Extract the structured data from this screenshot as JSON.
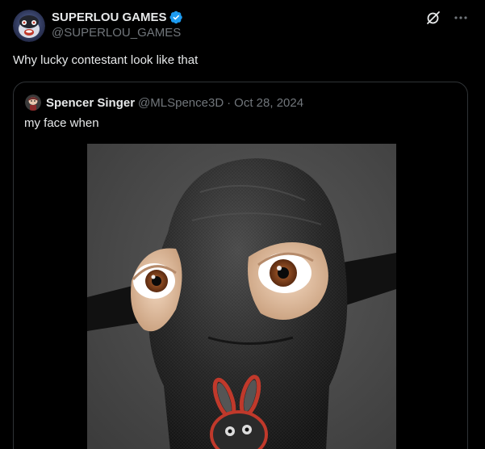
{
  "post": {
    "author_name": "SUPERLOU GAMES",
    "author_handle": "@SUPERLOU_GAMES",
    "text": "Why lucky contestant look like that"
  },
  "quote": {
    "author_name": "Spencer Singer",
    "author_handle": "@MLSpence3D",
    "separator": "·",
    "date": "Oct 28, 2024",
    "text": "my face when"
  },
  "icons": {
    "verified": "verified-badge-icon",
    "grok": "grok-icon",
    "more": "more-icon"
  },
  "colors": {
    "background": "#000000",
    "text_primary": "#e7e9ea",
    "text_secondary": "#71767b",
    "verified_blue": "#1d9bf0",
    "border": "#2f3336"
  }
}
